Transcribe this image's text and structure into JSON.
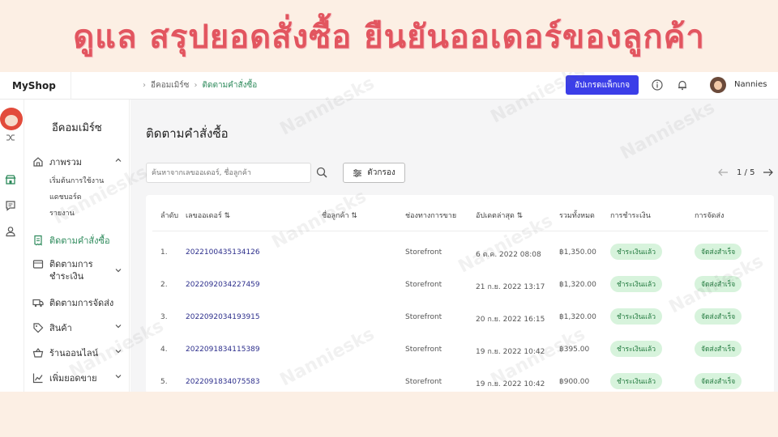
{
  "banner": {
    "title": "ดูแล สรุปยอดสั่งซื้อ ยืนยันออเดอร์ของลูกค้า"
  },
  "app": {
    "logo": "MyShop",
    "breadcrumb": [
      "อีคอมเมิร์ซ",
      "ติดตามคำสั่งซื้อ"
    ],
    "upgrade_label": "อัปเกรดแพ็กเกจ",
    "username": "Nannies"
  },
  "sidebar": {
    "title": "อีคอมเมิร์ซ",
    "overview": {
      "label": "ภาพรวม",
      "subitems": [
        "เริ่มต้นการใช้งาน",
        "แดชบอร์ด",
        "รายงาน"
      ]
    },
    "items": [
      {
        "label": "ติดตามคำสั่งซื้อ",
        "active": true
      },
      {
        "label": "ติดตามการ ชำระเงิน"
      },
      {
        "label": "ติดตามการจัดส่ง"
      },
      {
        "label": "สินค้า"
      },
      {
        "label": "ร้านออนไลน์"
      },
      {
        "label": "เพิ่มยอดขาย"
      }
    ]
  },
  "main": {
    "title": "ติดตามคำสั่งซื้อ",
    "search_placeholder": "ค้นหาจากเลขออเดอร์, ชื่อลูกค้า",
    "filter_label": "ตัวกรอง",
    "pagination": "1 / 5",
    "columns": [
      "ลำดับ",
      "เลขออเดอร์ ⇅",
      "ชื่อลูกค้า ⇅",
      "ช่องทางการขาย",
      "อัปเดตล่าสุด ⇅",
      "รวมทั้งหมด",
      "การชำระเงิน",
      "การจัดส่ง"
    ],
    "rows": [
      {
        "no": "1.",
        "order": "2022100435134126",
        "customer": "",
        "channel": "Storefront",
        "updated": "6 ต.ค. 2022 08:08",
        "total": "฿1,350.00",
        "payment": "ชำระเงินแล้ว",
        "shipping": "จัดส่งสำเร็จ"
      },
      {
        "no": "2.",
        "order": "2022092034227459",
        "customer": "",
        "channel": "Storefront",
        "updated": "21 ก.ย. 2022 13:17",
        "total": "฿1,320.00",
        "payment": "ชำระเงินแล้ว",
        "shipping": "จัดส่งสำเร็จ"
      },
      {
        "no": "3.",
        "order": "2022092034193915",
        "customer": "",
        "channel": "Storefront",
        "updated": "20 ก.ย. 2022 16:15",
        "total": "฿1,320.00",
        "payment": "ชำระเงินแล้ว",
        "shipping": "จัดส่งสำเร็จ"
      },
      {
        "no": "4.",
        "order": "2022091834115389",
        "customer": "",
        "channel": "Storefront",
        "updated": "19 ก.ย. 2022 10:42",
        "total": "฿395.00",
        "payment": "ชำระเงินแล้ว",
        "shipping": "จัดส่งสำเร็จ"
      },
      {
        "no": "5.",
        "order": "2022091834075583",
        "customer": "",
        "channel": "Storefront",
        "updated": "19 ก.ย. 2022 10:42",
        "total": "฿900.00",
        "payment": "ชำระเงินแล้ว",
        "shipping": "จัดส่งสำเร็จ"
      }
    ]
  },
  "watermark": "Nanniesks",
  "colors": {
    "banner": "#e2555f",
    "accent": "#3b3ee8",
    "active": "#2d8a5b",
    "badge_bg": "#d7f3dc"
  }
}
